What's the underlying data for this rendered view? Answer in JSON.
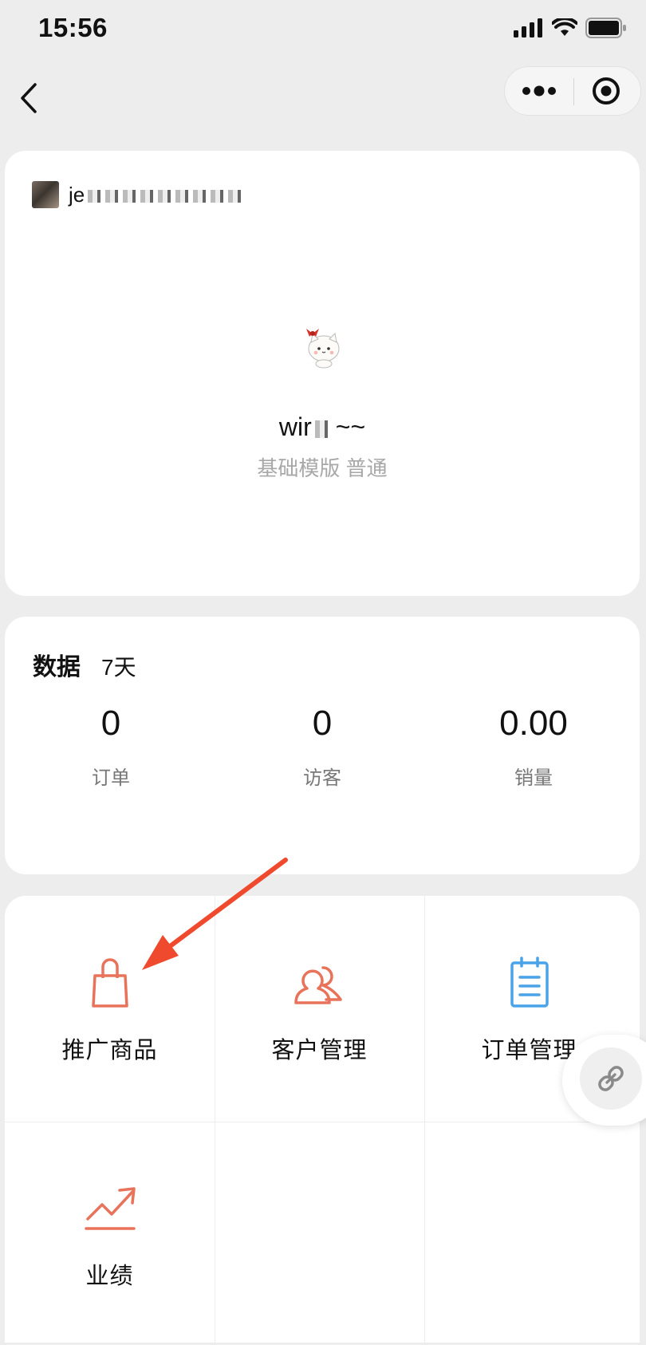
{
  "status_bar": {
    "time": "15:56",
    "icons": [
      "signal-icon",
      "wifi-icon",
      "battery-icon"
    ]
  },
  "nav": {
    "back_icon": "chevron-left-icon",
    "more_icon": "more-dots-icon",
    "close_icon": "target-icon"
  },
  "profile": {
    "username_visible": "je",
    "avatar": "koala-avatar",
    "shop_avatar": "cat-avatar",
    "shop_name_visible": "wir",
    "shop_name_suffix": "~~",
    "template_label": "基础模版 普通"
  },
  "stats": {
    "title": "数据",
    "range": "7天",
    "items": [
      {
        "value": "0",
        "label": "订单"
      },
      {
        "value": "0",
        "label": "访客"
      },
      {
        "value": "0.00",
        "label": "销量"
      }
    ]
  },
  "menu": [
    {
      "label": "推广商品",
      "icon": "shopping-bag-icon",
      "color": "#e8735a"
    },
    {
      "label": "客户管理",
      "icon": "users-icon",
      "color": "#e8735a"
    },
    {
      "label": "订单管理",
      "icon": "notepad-icon",
      "color": "#4aa3e8"
    },
    {
      "label": "业绩",
      "icon": "trend-up-icon",
      "color": "#e8735a"
    }
  ],
  "floating": {
    "icon": "link-icon"
  },
  "colors": {
    "background": "#ededed",
    "card": "#ffffff",
    "accent": "#e8735a",
    "blue": "#4aa3e8",
    "annotation_arrow": "#f04a2e"
  }
}
